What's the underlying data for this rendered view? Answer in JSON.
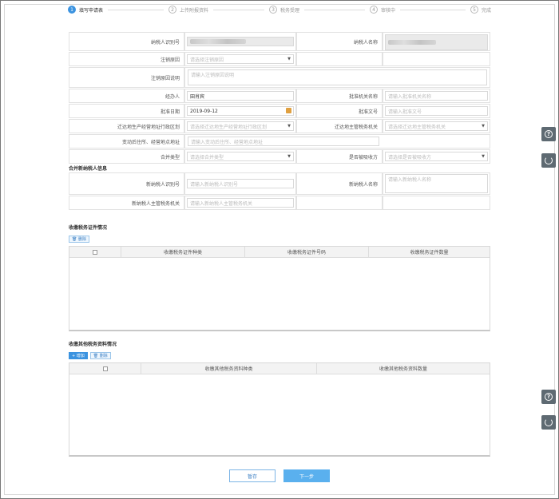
{
  "steps": [
    {
      "num": "1",
      "label": "填写申请表",
      "active": true
    },
    {
      "num": "2",
      "label": "上传附报资料"
    },
    {
      "num": "3",
      "label": "税务受理"
    },
    {
      "num": "4",
      "label": "审核中"
    },
    {
      "num": "5",
      "label": "完成"
    }
  ],
  "form": {
    "taxpayer_id_label": "纳税人识别号",
    "taxpayer_name_label": "纳税人名称",
    "cancel_reason_label": "注销原因",
    "cancel_reason_placeholder": "请选择注销原因",
    "cancel_reason_desc_label": "注销原因说明",
    "cancel_reason_desc_placeholder": "请输入注销原因说明",
    "handler_label": "经办人",
    "handler_value": "田肖宾",
    "approval_org_label": "批准机关名称",
    "approval_org_placeholder": "请输入批准机关名称",
    "approval_date_label": "批准日期",
    "approval_date_value": "2019-09-12",
    "approval_doc_label": "批准文号",
    "approval_doc_placeholder": "请输入批准文号",
    "move_region_label": "迁达地生产经营地址行政区划",
    "move_region_placeholder": "请选择迁达地生产经营地址行政区划",
    "move_tax_org_label": "迁达地主管税务机关",
    "move_tax_org_placeholder": "请选择迁达地主管税务机关",
    "address_label": "变动后住所、经营地点地址",
    "address_placeholder": "请输入变动后住所、经营地点地址",
    "merge_type_label": "合并类型",
    "merge_type_placeholder": "请选择合并类型",
    "continue_label": "是否被吸收方",
    "continue_placeholder": "请选择是否被吸收方",
    "new_taxpayer_section": "合并新纳税人信息",
    "new_taxpayer_id_label": "新纳税人识别号",
    "new_taxpayer_id_placeholder": "请输入新纳税人识别号",
    "new_taxpayer_name_label": "新纳税人名称",
    "new_taxpayer_name_placeholder": "请输入新纳税人名称",
    "new_tax_org_label": "新纳税人主管税务机关",
    "new_tax_org_placeholder": "请输入新纳税人主管税务机关"
  },
  "certs": {
    "title": "收缴税务证件情况",
    "delete_label": "删除",
    "columns": [
      "收缴税务证件种类",
      "收缴税务证件号码",
      "收缴税务证件数量"
    ]
  },
  "others": {
    "title": "收缴其他税务资料情况",
    "add_label": "+ 增加",
    "delete_label": "删除",
    "columns": [
      "收缴其他税务资料种类",
      "收缴其他税务资料数量"
    ]
  },
  "footer": {
    "save_label": "暂存",
    "next_label": "下一步"
  },
  "side": {
    "help_glyph": "?"
  }
}
